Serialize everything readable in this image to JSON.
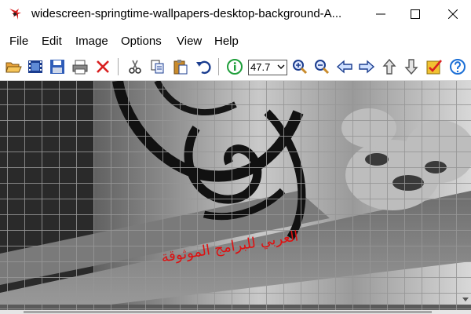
{
  "window": {
    "title": "widescreen-springtime-wallpapers-desktop-background-A...",
    "icons": {
      "app": "irfanview-cat-icon",
      "minimize": "minimize-icon",
      "maximize": "maximize-icon",
      "close": "close-icon"
    }
  },
  "menu": {
    "file": "File",
    "edit": "Edit",
    "image": "Image",
    "options": "Options",
    "view": "View",
    "help": "Help"
  },
  "toolbar": {
    "zoom_value": "47.7",
    "tools": [
      "open-folder-icon",
      "filmstrip-icon",
      "save-icon",
      "print-icon",
      "delete-icon",
      "cut-icon",
      "copy-icon",
      "paste-icon",
      "undo-icon",
      "info-icon",
      "zoom-in-icon",
      "zoom-out-icon",
      "previous-icon",
      "next-icon",
      "first-icon",
      "last-icon",
      "settings-check-icon",
      "help-icon"
    ]
  },
  "image": {
    "watermark": "العربي للبرامج الموثوقة",
    "colors": {
      "grid": "#969696",
      "watermark": "#dd1111"
    }
  }
}
